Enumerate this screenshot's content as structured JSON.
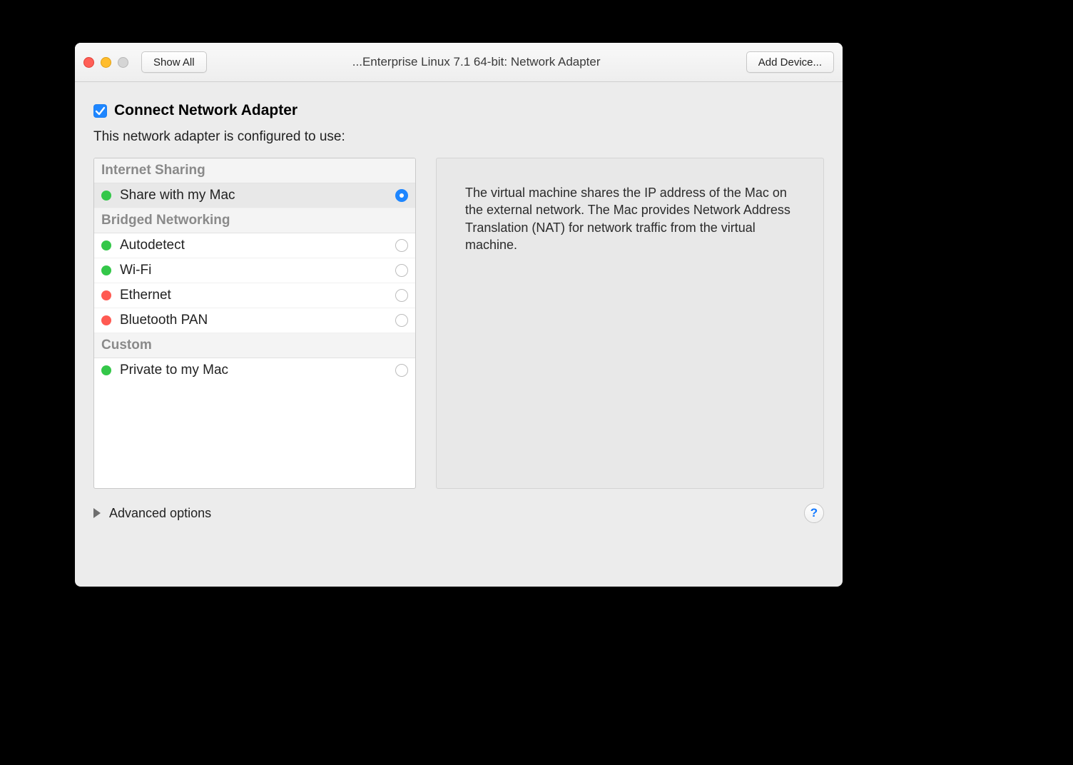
{
  "titlebar": {
    "show_all": "Show All",
    "title": "...Enterprise Linux 7.1 64-bit: Network Adapter",
    "add_device": "Add Device..."
  },
  "checkbox": {
    "connect_label": "Connect Network Adapter",
    "checked": true
  },
  "subhead": "This network adapter is configured to use:",
  "sections": [
    {
      "header": "Internet Sharing",
      "items": [
        {
          "label": "Share with my Mac",
          "status": "green",
          "selected": true
        }
      ]
    },
    {
      "header": "Bridged Networking",
      "items": [
        {
          "label": "Autodetect",
          "status": "green",
          "selected": false
        },
        {
          "label": "Wi-Fi",
          "status": "green",
          "selected": false
        },
        {
          "label": "Ethernet",
          "status": "red",
          "selected": false
        },
        {
          "label": "Bluetooth PAN",
          "status": "red",
          "selected": false
        }
      ]
    },
    {
      "header": "Custom",
      "items": [
        {
          "label": "Private to my Mac",
          "status": "green",
          "selected": false
        }
      ]
    }
  ],
  "description": "The virtual machine shares the IP address of the Mac on the external network. The Mac provides Network Address Translation (NAT) for network traffic from the virtual machine.",
  "advanced_label": "Advanced options",
  "help_label": "?",
  "colors": {
    "accent": "#1e86ff",
    "status_green": "#34c749",
    "status_red": "#ff5a52"
  }
}
